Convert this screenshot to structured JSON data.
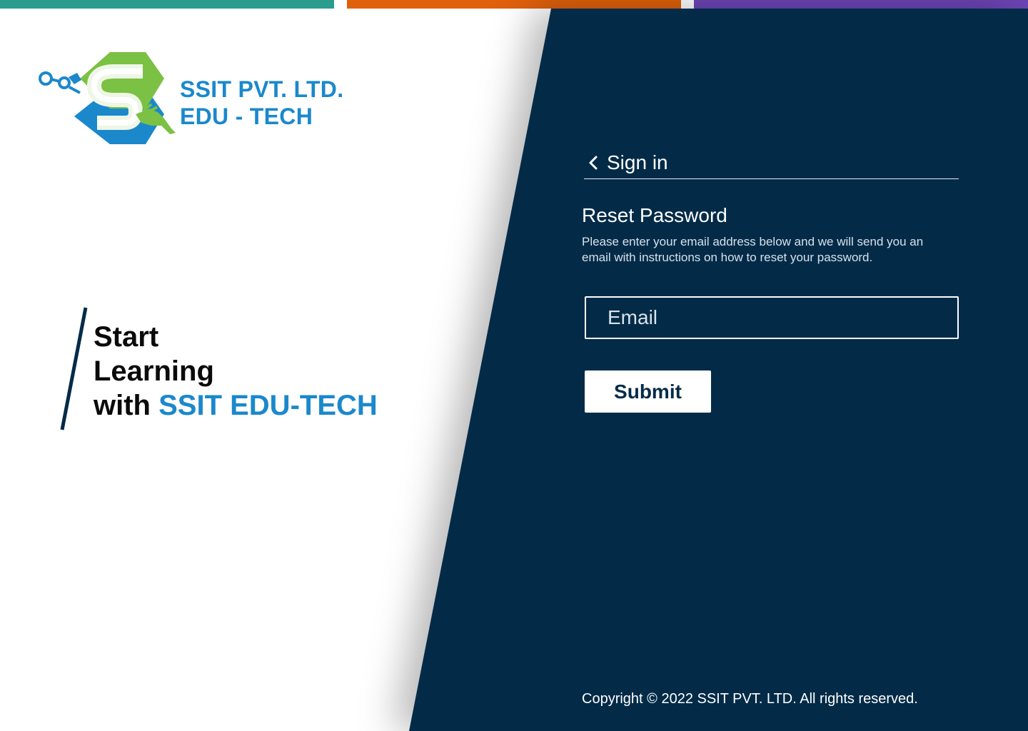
{
  "colors": {
    "bar1": "#2a9d8f",
    "bar2": "#e0600b",
    "bar3": "#6c45b6",
    "panel": "#032b48",
    "brand_blue": "#1b88cc",
    "brand_green": "#7bc143"
  },
  "brand": {
    "line1": "SSIT PVT. LTD.",
    "line2": "EDU - TECH",
    "logo_icon": "ssit-s-logo"
  },
  "tagline": {
    "line1": "Start",
    "line2": "Learning",
    "line3_prefix": "with ",
    "line3_accent": "SSIT EDU-TECH"
  },
  "signin_back": {
    "icon": "chevron-left-icon",
    "label": "Sign in"
  },
  "reset": {
    "title": "Reset Password",
    "description": "Please enter your email address below and we will send you an email with instructions on how to reset your password.",
    "email_placeholder": "Email",
    "email_value": "",
    "submit_label": "Submit"
  },
  "footer": {
    "copyright": "Copyright © 2022 SSIT PVT. LTD. All rights reserved."
  }
}
